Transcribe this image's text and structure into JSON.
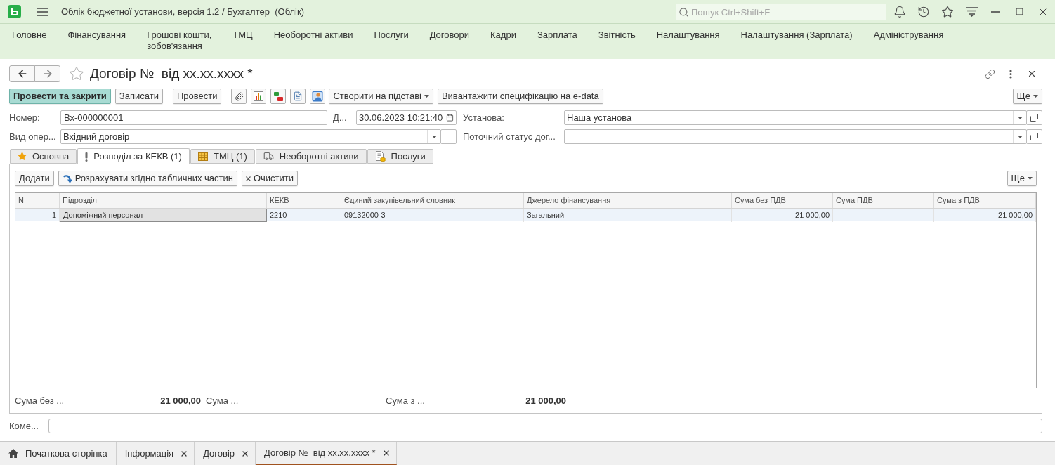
{
  "app_bar": {
    "title": "Облік бюджетної установи, версія 1.2 / Бухгалтер  (Облік)",
    "search": {
      "placeholder": "Пошук Ctrl+Shift+F"
    }
  },
  "sections": [
    {
      "label": "Головне"
    },
    {
      "label": "Фінансування"
    },
    {
      "label": "Грошові кошти,\nзобов'язання"
    },
    {
      "label": "ТМЦ"
    },
    {
      "label": "Необоротні активи"
    },
    {
      "label": "Послуги"
    },
    {
      "label": "Договори"
    },
    {
      "label": "Кадри"
    },
    {
      "label": "Зарплата"
    },
    {
      "label": "Звітність"
    },
    {
      "label": "Налаштування"
    },
    {
      "label": "Налаштування (Зарплата)"
    },
    {
      "label": "Адміністрування"
    }
  ],
  "form": {
    "title": "Договір №  від xx.xx.xxxx *",
    "favorite": false,
    "commands": [
      {
        "label": "Провести та закрити",
        "default": true
      },
      {
        "label": "Записати",
        "default": false
      },
      {
        "label": "Провести",
        "default": false
      }
    ],
    "menu_commands": [
      {
        "label": "Створити на підставі",
        "dropdown": true
      },
      {
        "label": "Вивантажити специфікацію на e-data",
        "dropdown": false
      }
    ],
    "more": "Ще",
    "field_rows": [
      [
        {
          "label": "Номер:",
          "value": "Вх-000000001",
          "kind": "text"
        },
        {
          "label": "Д...",
          "value": "30.06.2023 10:21:40",
          "kind": "date"
        },
        {
          "label": "Установа:",
          "value": "Наша установа",
          "kind": "select"
        }
      ],
      [
        {
          "label": "Вид опер...",
          "value": "Вхідний договір",
          "kind": "select"
        },
        {
          "label": "Поточний статус дог...",
          "kind": "select"
        }
      ]
    ],
    "tabs": [
      {
        "label": "Основна",
        "selected": false
      },
      {
        "label": "Розподіл за КЕКВ (1)",
        "selected": true
      },
      {
        "label": "ТМЦ (1)",
        "selected": false
      },
      {
        "label": "Необоротні активи",
        "selected": false
      },
      {
        "label": "Послуги",
        "selected": false
      }
    ],
    "panel": {
      "toolbar": [
        {
          "label": "Додати"
        },
        {
          "label": "Розрахувати згідно табличних частин"
        },
        {
          "label": "Очистити"
        }
      ],
      "more": "Ще",
      "table": {
        "columns": [
          {
            "label": "N",
            "kind": "number"
          },
          {
            "label": "Підрозділ",
            "kind": "text"
          },
          {
            "label": "КЕКВ",
            "kind": "text"
          },
          {
            "label": "Єдиний закупівельний словник",
            "kind": "text"
          },
          {
            "label": "Джерело фінансування",
            "kind": "text"
          },
          {
            "label": "Сума без ПДВ",
            "kind": "number"
          },
          {
            "label": "Сума ПДВ",
            "kind": "number"
          },
          {
            "label": "Сума з ПДВ",
            "kind": "number"
          }
        ],
        "rows": [
          {
            "selected": true,
            "cells": [
              {
                "text": "1",
                "current": false
              },
              {
                "text": "Допоміжний персонал",
                "current": true
              },
              {
                "text": "2210",
                "current": false
              },
              {
                "text": "09132000-3",
                "current": false
              },
              {
                "text": "Загальний",
                "current": false
              },
              {
                "text": "21 000,00",
                "current": false
              },
              {
                "current": false
              },
              {
                "text": "21 000,00",
                "current": false
              }
            ]
          }
        ]
      },
      "totals": [
        {
          "label": "Сума без ...",
          "value": "21 000,00"
        },
        {
          "label": "Сума ..."
        },
        {
          "label": "Сума з ...",
          "value": "21 000,00"
        }
      ]
    },
    "comment": {
      "label": "Коме..."
    }
  },
  "open_windows": [
    {
      "label": "Початкова сторінка",
      "kind": "home",
      "closable": false,
      "selected": false
    },
    {
      "label": "Інформація",
      "kind": "page",
      "closable": true,
      "selected": false
    },
    {
      "label": "Договір",
      "kind": "page",
      "closable": true,
      "selected": false
    },
    {
      "label": "Договір №  від xx.xx.xxxx *",
      "kind": "page",
      "closable": true,
      "selected": true
    }
  ]
}
